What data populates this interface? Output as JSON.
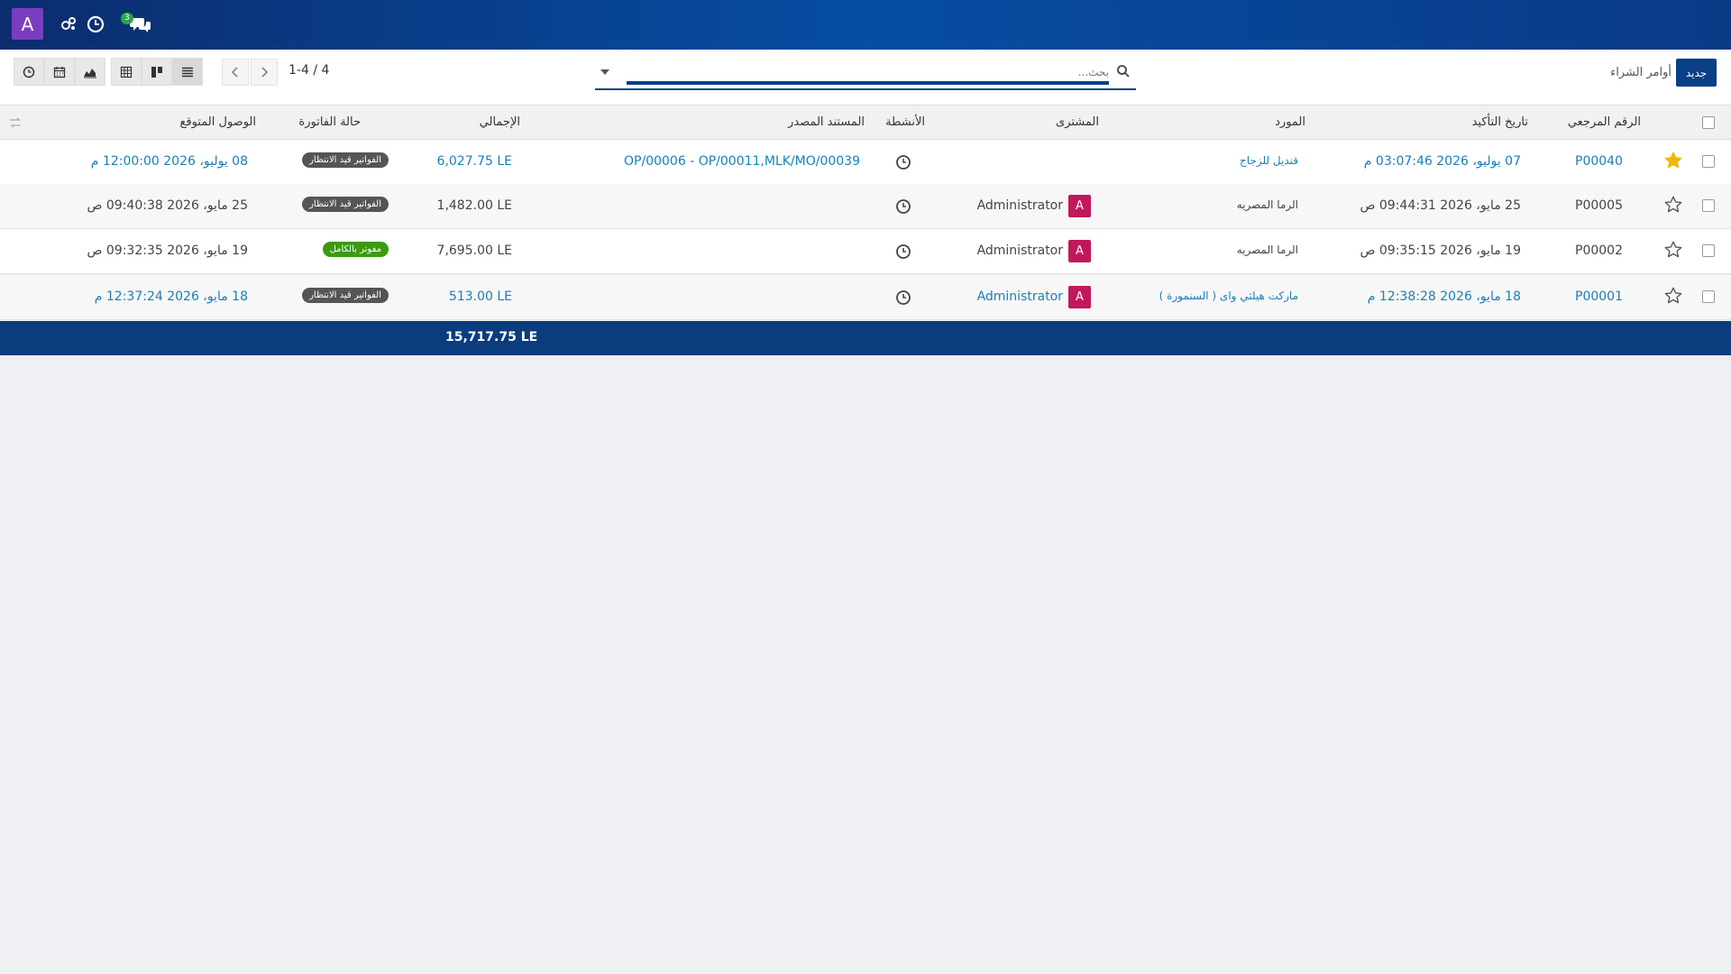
{
  "topbar": {
    "user_initial": "A",
    "chat_badge": "3",
    "icons": [
      "apps-switch-icon",
      "clock-icon",
      "chat-icon"
    ]
  },
  "control": {
    "new_button": "جديد",
    "breadcrumb": "أوامر الشراء",
    "search_placeholder": "بحث...",
    "pager": "1-4 / 4",
    "views": [
      "list-icon",
      "kanban-icon",
      "pivot-icon",
      "graph-icon",
      "calendar-icon",
      "activity-icon"
    ]
  },
  "table": {
    "headers": {
      "ref": "الرقم المرجعي",
      "confirm_date": "تاريخ التأكيد",
      "vendor": "المورد",
      "buyer": "المشترى",
      "activities": "الأنشطة",
      "source": "المستند المصدر",
      "total": "الإجمالي",
      "invoice_status": "حالة الفاتورة",
      "expected_arrival": "الوصول المتوقع"
    },
    "rows": [
      {
        "ref": "P00040",
        "starred": true,
        "confirm_date": "07 يوليو، 2026 03:07:46 م",
        "vendor": "قنديل للزجاج",
        "buyer_initial": "",
        "buyer": "",
        "source": "OP/00006 - OP/00011,MLK/MO/00039",
        "total": "6,027.75 LE",
        "invoice_status": "الفواتير قيد الانتظار",
        "status_kind": "pending",
        "expected_arrival": "08 يوليو، 2026 12:00:00 م",
        "style": "link"
      },
      {
        "ref": "P00005",
        "starred": false,
        "confirm_date": "25 مايو، 2026 09:44:31 ص",
        "vendor": "الرما المصريه",
        "buyer_initial": "A",
        "buyer": "Administrator",
        "source": "",
        "total": "1,482.00 LE",
        "invoice_status": "الفواتير قيد الانتظار",
        "status_kind": "pending",
        "expected_arrival": "25 مايو، 2026 09:40:38 ص",
        "style": "plain"
      },
      {
        "ref": "P00002",
        "starred": false,
        "confirm_date": "19 مايو، 2026 09:35:15 ص",
        "vendor": "الرما المصريه",
        "buyer_initial": "A",
        "buyer": "Administrator",
        "source": "",
        "total": "7,695.00 LE",
        "invoice_status": "مفوتر بالكامل",
        "status_kind": "done",
        "expected_arrival": "19 مايو، 2026 09:32:35 ص",
        "style": "plain"
      },
      {
        "ref": "P00001",
        "starred": false,
        "confirm_date": "18 مايو، 2026 12:38:28 م",
        "vendor": "ماركت هيلثي واى ( السنمورة )",
        "buyer_initial": "A",
        "buyer": "Administrator",
        "source": "",
        "total": "513.00 LE",
        "invoice_status": "الفواتير قيد الانتظار",
        "status_kind": "pending",
        "expected_arrival": "18 مايو، 2026 12:37:24 م",
        "style": "link"
      }
    ],
    "footer_total": "15,717.75 LE"
  },
  "colors": {
    "primary": "#0b3f86",
    "link": "#1a7fb5",
    "star": "#f3b700",
    "avatar": "#c2185b",
    "status_done": "#3b9a12",
    "status_pending": "#555555"
  }
}
